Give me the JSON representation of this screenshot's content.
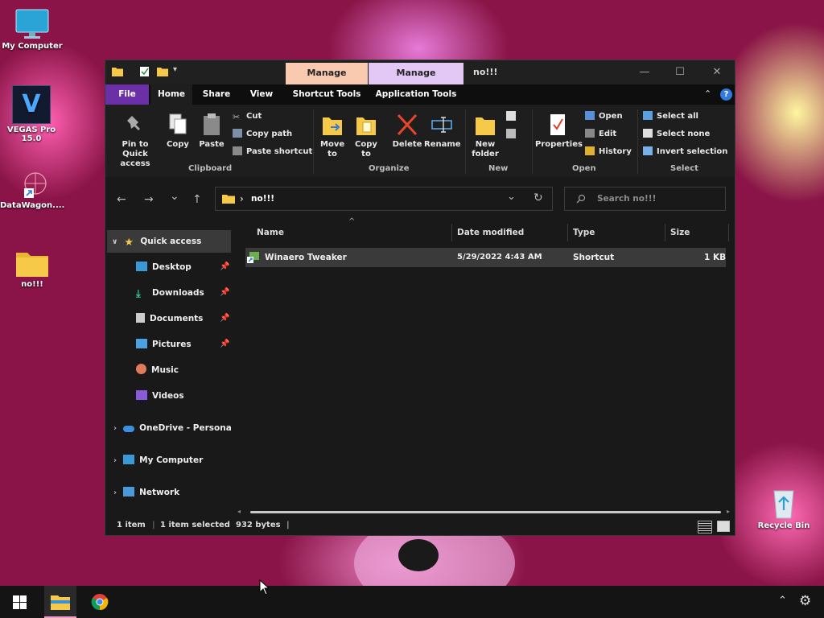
{
  "desktop": {
    "icons": [
      {
        "label": "My Computer"
      },
      {
        "label": "VEGAS Pro 15.0",
        "glyph": "V"
      },
      {
        "label": "DataWagon...."
      },
      {
        "label": "no!!!"
      },
      {
        "label": "Recycle Bin"
      }
    ]
  },
  "window": {
    "title": "no!!!",
    "context_tabs": [
      {
        "label": "Manage",
        "color": "#f9c9b0"
      },
      {
        "label": "Manage",
        "color": "#e3c8f6"
      }
    ],
    "controls": {
      "minimize": "—",
      "maximize": "☐",
      "close": "✕"
    },
    "tabs": [
      {
        "label": "File"
      },
      {
        "label": "Home"
      },
      {
        "label": "Share"
      },
      {
        "label": "View"
      },
      {
        "label": "Shortcut Tools"
      },
      {
        "label": "Application Tools"
      }
    ],
    "ribbon": {
      "clipboard": {
        "group_label": "Clipboard",
        "pin": "Pin to Quick access",
        "copy": "Copy",
        "paste": "Paste",
        "cut": "Cut",
        "copy_path": "Copy path",
        "paste_shortcut": "Paste shortcut"
      },
      "organize": {
        "group_label": "Organize",
        "move_to": "Move to",
        "copy_to": "Copy to",
        "delete": "Delete",
        "rename": "Rename"
      },
      "new": {
        "group_label": "New",
        "new_folder": "New folder"
      },
      "open": {
        "group_label": "Open",
        "properties": "Properties",
        "open": "Open",
        "edit": "Edit",
        "history": "History"
      },
      "select": {
        "group_label": "Select",
        "select_all": "Select all",
        "select_none": "Select none",
        "invert_selection": "Invert selection"
      }
    },
    "nav": {
      "back": "←",
      "forward": "→",
      "recent": "⌄",
      "up": "↑",
      "path_sep": "›",
      "path": "no!!!",
      "search_placeholder": "Search no!!!",
      "refresh": "↻",
      "dropdown": "⌄"
    },
    "navpane": {
      "quick_access": "Quick access",
      "items": [
        {
          "label": "Desktop",
          "pinned": true
        },
        {
          "label": "Downloads",
          "pinned": true
        },
        {
          "label": "Documents",
          "pinned": true
        },
        {
          "label": "Pictures",
          "pinned": true
        },
        {
          "label": "Music",
          "pinned": false
        },
        {
          "label": "Videos",
          "pinned": false
        }
      ],
      "roots": [
        {
          "label": "OneDrive - Persona"
        },
        {
          "label": "My Computer"
        },
        {
          "label": "Network"
        }
      ]
    },
    "columns": [
      "Name",
      "Date modified",
      "Type",
      "Size"
    ],
    "files": [
      {
        "name": "Winaero Tweaker",
        "date": "5/29/2022 4:43 AM",
        "type": "Shortcut",
        "size": "1 KB"
      }
    ],
    "status": {
      "count": "1 item",
      "selected": "1 item selected",
      "bytes": "932 bytes"
    }
  },
  "taskbar": {
    "start": "start-icon",
    "apps": [
      "file-explorer-icon",
      "chrome-icon"
    ]
  },
  "colors": {
    "file_tab": "#6b2fa8",
    "accent_blue": "#2f7be0",
    "folder": "#f7c948",
    "selection": "#3a3a3a"
  }
}
